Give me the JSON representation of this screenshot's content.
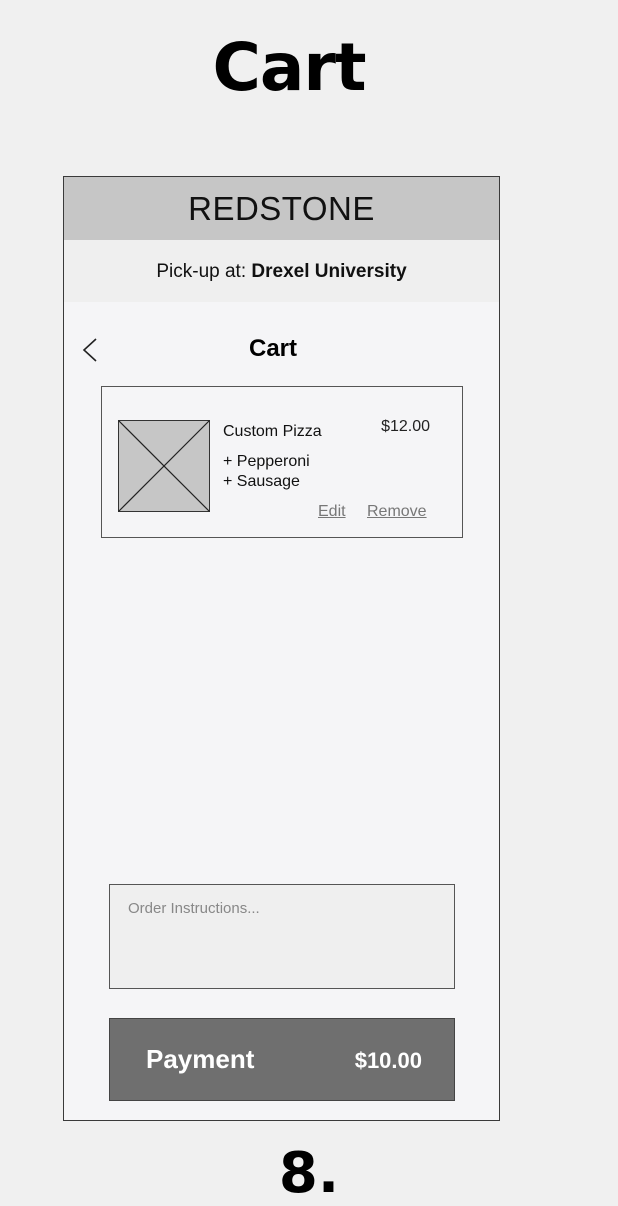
{
  "page_title": "Cart",
  "screen_number": "8.",
  "app": {
    "brand": "REDSTONE",
    "pickup_label": "Pick-up at:",
    "pickup_location": "Drexel University"
  },
  "cart": {
    "heading": "Cart",
    "back_icon": "chevron-left-icon",
    "items": [
      {
        "name": "Custom Pizza",
        "price": "$12.00",
        "toppings": [
          "+ Pepperoni",
          "+ Sausage"
        ],
        "edit_label": "Edit",
        "remove_label": "Remove"
      }
    ]
  },
  "instructions": {
    "placeholder": "Order Instructions..."
  },
  "payment": {
    "label": "Payment",
    "total": "$10.00"
  },
  "colors": {
    "brand_bar": "#c6c6c6",
    "payment_button": "#6f6f6f"
  }
}
